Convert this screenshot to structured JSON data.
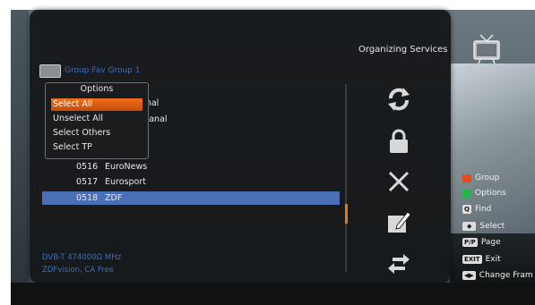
{
  "header": {
    "title": "Organizing Services",
    "group_label": "Group:Fav Group 1"
  },
  "options_popup": {
    "title": "Options",
    "items": [
      {
        "label": "Select All",
        "active": true
      },
      {
        "label": "Unselect All",
        "active": false
      },
      {
        "label": "Select Others",
        "active": false
      },
      {
        "label": "Select TP",
        "active": false
      }
    ]
  },
  "channel_list": {
    "partial_rows": [
      {
        "name_fragment": "anal"
      },
      {
        "name_fragment": "rkanal"
      }
    ],
    "rows": [
      {
        "number": "0516",
        "name": "EuroNews",
        "selected": false
      },
      {
        "number": "0517",
        "name": "Eurosport",
        "selected": false
      },
      {
        "number": "0518",
        "name": "ZDF",
        "selected": true
      }
    ]
  },
  "info": {
    "line1": "DVB-T 474000Ω MHz",
    "line2": "ZDFvision, CA Free"
  },
  "side_icons": [
    "refresh-icon",
    "lock-icon",
    "delete-icon",
    "edit-icon",
    "move-icon"
  ],
  "legend": {
    "items": [
      {
        "type": "color",
        "color": "#e84a1a",
        "label": "Group",
        "icon": "red-key-icon"
      },
      {
        "type": "color",
        "color": "#27b24a",
        "label": "Options",
        "icon": "green-key-icon"
      },
      {
        "type": "key",
        "key": "Q",
        "label": "Find",
        "icon": "find-key-icon"
      },
      {
        "type": "key",
        "key": "◆",
        "label": "Select",
        "icon": "ok-key-icon"
      },
      {
        "type": "key",
        "key": "P/P",
        "label": "Page",
        "icon": "page-key-icon"
      },
      {
        "type": "key",
        "key": "EXIT",
        "label": "Exit",
        "icon": "exit-key-icon"
      },
      {
        "type": "key",
        "key": "◀▶",
        "label": "Change Fram",
        "icon": "leftright-key-icon"
      }
    ]
  },
  "colors": {
    "dialog_bg": "#16181a",
    "selection": "#4a6fb5",
    "active_option": "#e0621a",
    "info_text": "#3d6fb8"
  }
}
